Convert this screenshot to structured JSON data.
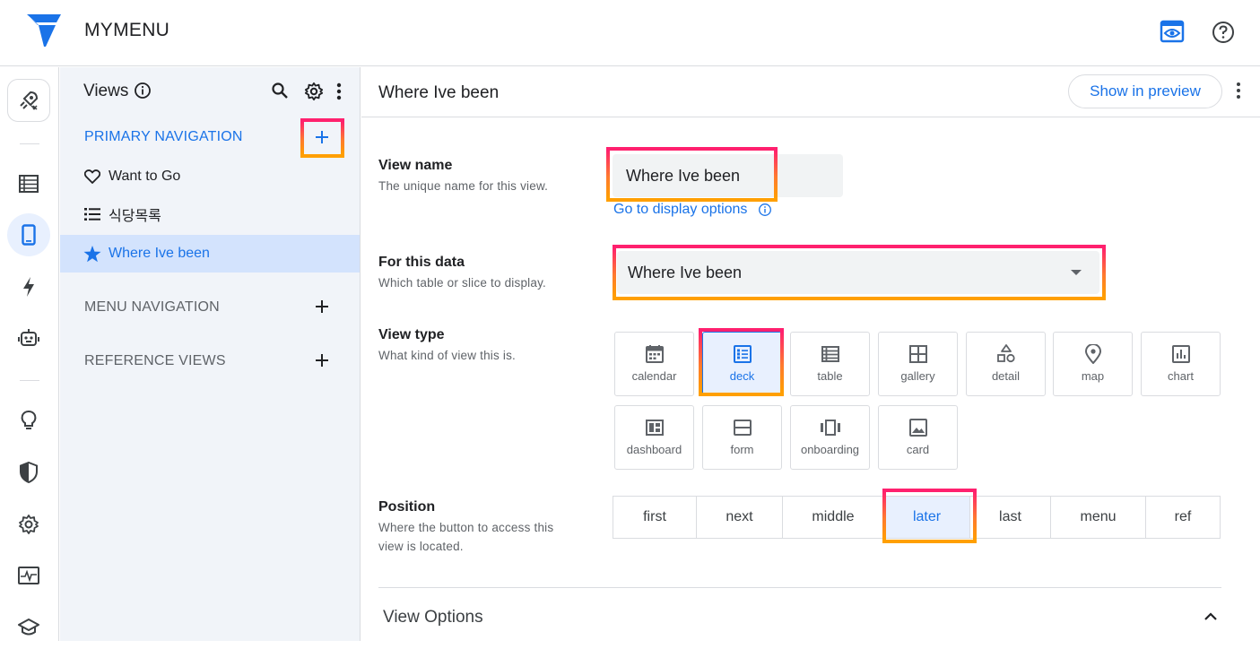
{
  "app": {
    "title": "MYMENU"
  },
  "colors": {
    "accent": "#1a73e8",
    "highlight_top": "#ff1f6f",
    "highlight_bottom": "#ffa000"
  },
  "rail": {
    "items": [
      "rocket-icon",
      "table-icon",
      "phone-icon",
      "bolt-icon",
      "robot-icon",
      "bulb-icon",
      "shield-icon",
      "gear-icon",
      "pulse-icon",
      "school-icon"
    ],
    "active": "phone-icon"
  },
  "panel": {
    "title": "Views",
    "primary_navigation": "PRIMARY NAVIGATION",
    "menu_navigation": "MENU NAVIGATION",
    "reference_views": "REFERENCE VIEWS",
    "items": [
      {
        "label": "Want to Go",
        "icon": "heart-icon"
      },
      {
        "label": "식당목록",
        "icon": "list-icon"
      },
      {
        "label": "Where Ive been",
        "icon": "star-icon",
        "selected": true
      }
    ]
  },
  "main": {
    "title": "Where Ive been",
    "show_in_preview": "Show in preview",
    "view_name": {
      "label": "View name",
      "help": "The unique name for this view.",
      "value": "Where Ive been",
      "link": "Go to display options"
    },
    "for_this_data": {
      "label": "For this data",
      "help": "Which table or slice to display.",
      "value": "Where Ive been"
    },
    "view_type": {
      "label": "View type",
      "help": "What kind of view this is.",
      "options": [
        "calendar",
        "deck",
        "table",
        "gallery",
        "detail",
        "map",
        "chart",
        "dashboard",
        "form",
        "onboarding",
        "card"
      ],
      "selected": "deck"
    },
    "position": {
      "label": "Position",
      "help_line1": "Where the button to access this",
      "help_line2": "view is located.",
      "options": [
        "first",
        "next",
        "middle",
        "later",
        "last",
        "menu",
        "ref"
      ],
      "selected": "later"
    },
    "view_options": "View Options"
  }
}
